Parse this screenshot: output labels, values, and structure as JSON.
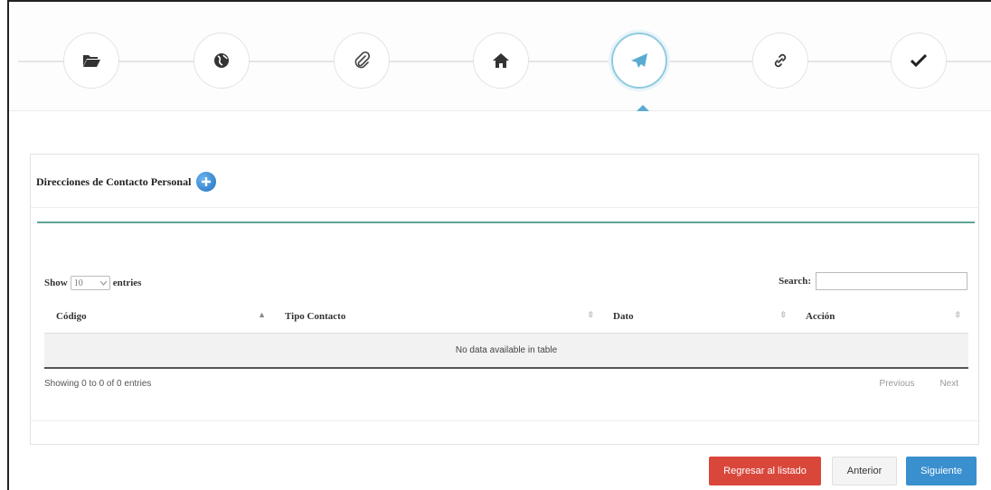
{
  "wizard": {
    "steps": [
      {
        "icon": "folder-open-icon"
      },
      {
        "icon": "globe-icon"
      },
      {
        "icon": "paperclip-icon"
      },
      {
        "icon": "home-icon"
      },
      {
        "icon": "send-icon",
        "active": true
      },
      {
        "icon": "link-icon"
      },
      {
        "icon": "check-icon"
      }
    ],
    "active_color": "#5aabd0"
  },
  "panel": {
    "title": "Direcciones de Contacto Personal",
    "add_icon": "plus-circle-icon"
  },
  "table": {
    "length": {
      "show_label": "Show",
      "value": "10",
      "entries_label": "entries"
    },
    "search_label": "Search:",
    "columns": [
      "Código",
      "Tipo Contacto",
      "Dato",
      "Acción"
    ],
    "empty_text": "No data available in table",
    "info": "Showing 0 to 0 of 0 entries",
    "pager": {
      "previous": "Previous",
      "next": "Next"
    }
  },
  "buttons": {
    "back_to_list": "Regresar al listado",
    "previous": "Anterior",
    "next": "Siguiente"
  },
  "colors": {
    "danger": "#d9473b",
    "primary": "#3a8fcf",
    "accent_line": "#5fa596"
  }
}
